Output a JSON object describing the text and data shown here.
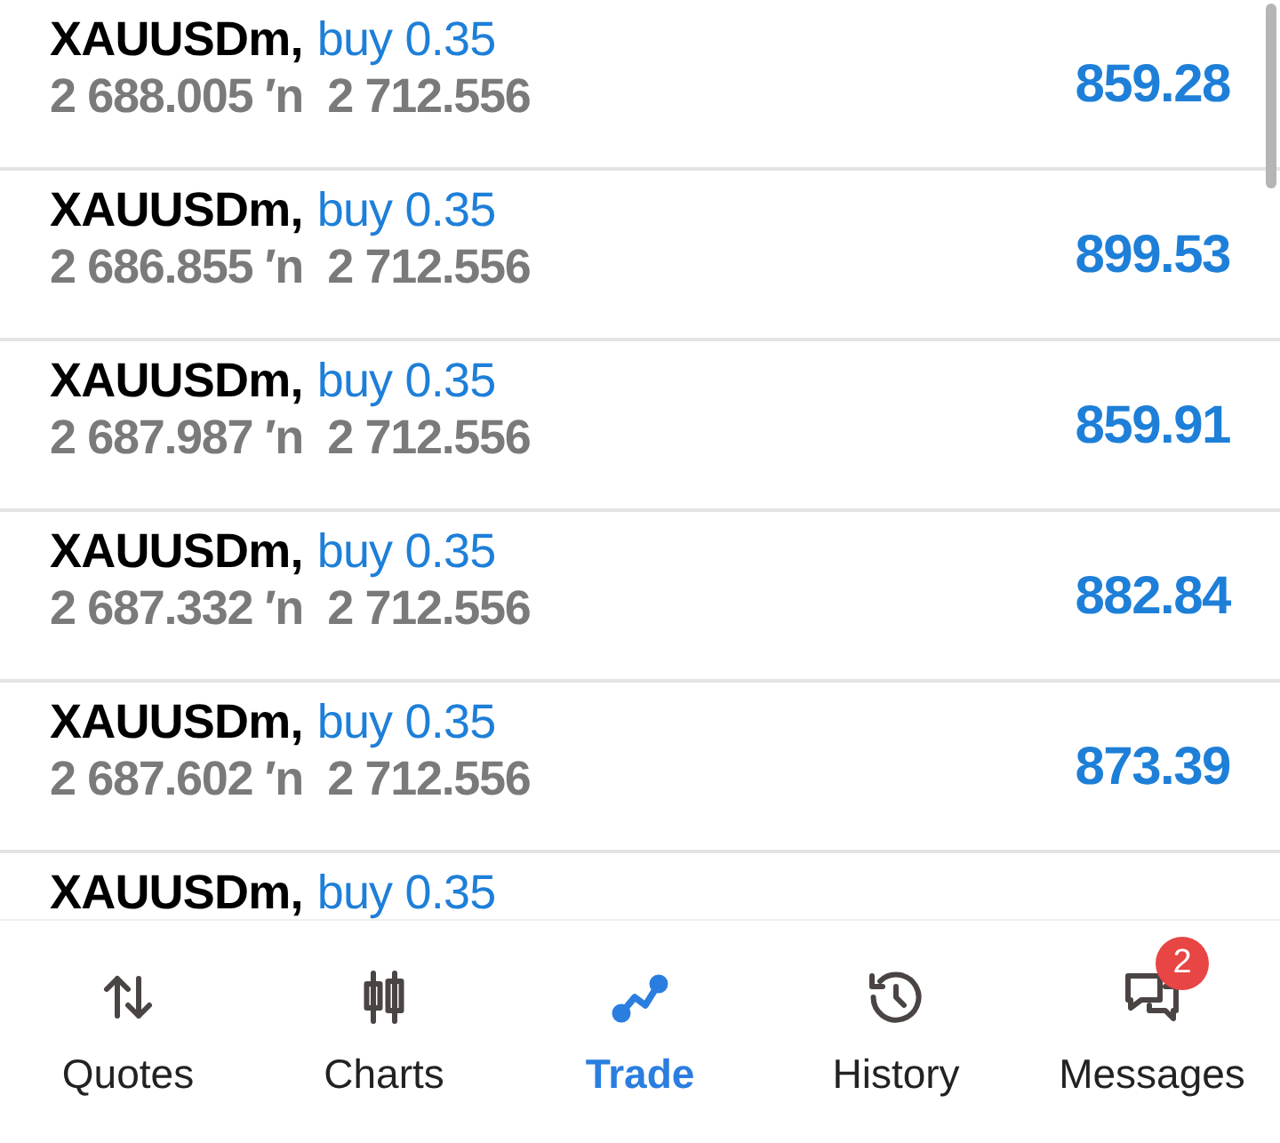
{
  "positions": [
    {
      "symbol": "XAUUSDm,",
      "side": "buy 0.35",
      "prices": "2 688.005 ′n  2 712.556",
      "profit": "859.28"
    },
    {
      "symbol": "XAUUSDm,",
      "side": "buy 0.35",
      "prices": "2 686.855 ′n  2 712.556",
      "profit": "899.53"
    },
    {
      "symbol": "XAUUSDm,",
      "side": "buy 0.35",
      "prices": "2 687.987 ′n  2 712.556",
      "profit": "859.91"
    },
    {
      "symbol": "XAUUSDm,",
      "side": "buy 0.35",
      "prices": "2 687.332 ′n  2 712.556",
      "profit": "882.84"
    },
    {
      "symbol": "XAUUSDm,",
      "side": "buy 0.35",
      "prices": "2 687.602 ′n  2 712.556",
      "profit": "873.39"
    },
    {
      "symbol": "XAUUSDm,",
      "side": "buy 0.35"
    }
  ],
  "nav": [
    {
      "label": "Quotes",
      "kind": "quotes",
      "selected": false
    },
    {
      "label": "Charts",
      "kind": "charts",
      "selected": false
    },
    {
      "label": "Trade",
      "kind": "trade",
      "selected": true
    },
    {
      "label": "History",
      "kind": "history",
      "selected": false
    },
    {
      "label": "Messages",
      "kind": "messages",
      "selected": false,
      "badge": "2"
    }
  ]
}
